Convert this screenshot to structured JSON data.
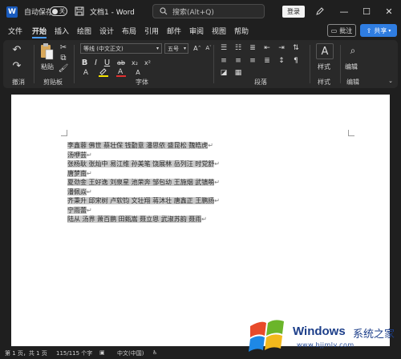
{
  "titlebar": {
    "autosave_label": "自动保存",
    "autosave_state": "关",
    "doc_title": "文档1 - Word",
    "search_placeholder": "搜索(Alt+Q)",
    "login_label": "登录",
    "window_controls": [
      "—",
      "☐",
      "✕"
    ]
  },
  "menu": {
    "tabs": [
      "文件",
      "开始",
      "插入",
      "绘图",
      "设计",
      "布局",
      "引用",
      "邮件",
      "审阅",
      "视图",
      "帮助"
    ],
    "active_tab": "开始",
    "comment_label": "批注",
    "share_label": "共享"
  },
  "ribbon": {
    "groups": {
      "undo": "撤消",
      "clipboard": "剪贴板",
      "font": "字体",
      "paragraph": "段落",
      "styles": "样式",
      "editing": "编辑"
    },
    "paste_label": "粘贴",
    "font_name": "等线 (中文正文)",
    "font_size": "五号",
    "styles_button": "样式",
    "editing_button": "编辑",
    "font_buttons": [
      "B",
      "I",
      "U",
      "ab",
      "x₂",
      "x²"
    ],
    "colors": {
      "highlight": "#f5e400",
      "font_color": "#e03030"
    }
  },
  "document": {
    "lines": [
      "李鑫蓉 佛世 蔡壮保 钱勤意 潘思依 盛昆松 魏皓虎",
      "汤咿芸",
      "张杨耿 张灿中 易江维 孙美笔 饶展林 岳列汪 时党舒",
      "唐梦南",
      "夏劲金 王好逸 刘泉星 池荣奔 邹包幼 王施烟 武镇萌",
      "潘佩焱",
      "齐秉升 邱宋树 卢软钧 文壮翔 蒋沐壮 唐鑫正 王鹏扬",
      "宁雨蕾",
      "陆从 汤界 萧百鹏 田甄嵩 聂立恩 武淑苏韵 聂雨"
    ]
  },
  "statusbar": {
    "page": "第 1 页，共 1 页",
    "words": "115/115 个字",
    "language": "中文(中国)"
  },
  "watermark": {
    "brand": "Windows",
    "suffix": "系统之家",
    "url": "www.bjjmlv.com"
  }
}
